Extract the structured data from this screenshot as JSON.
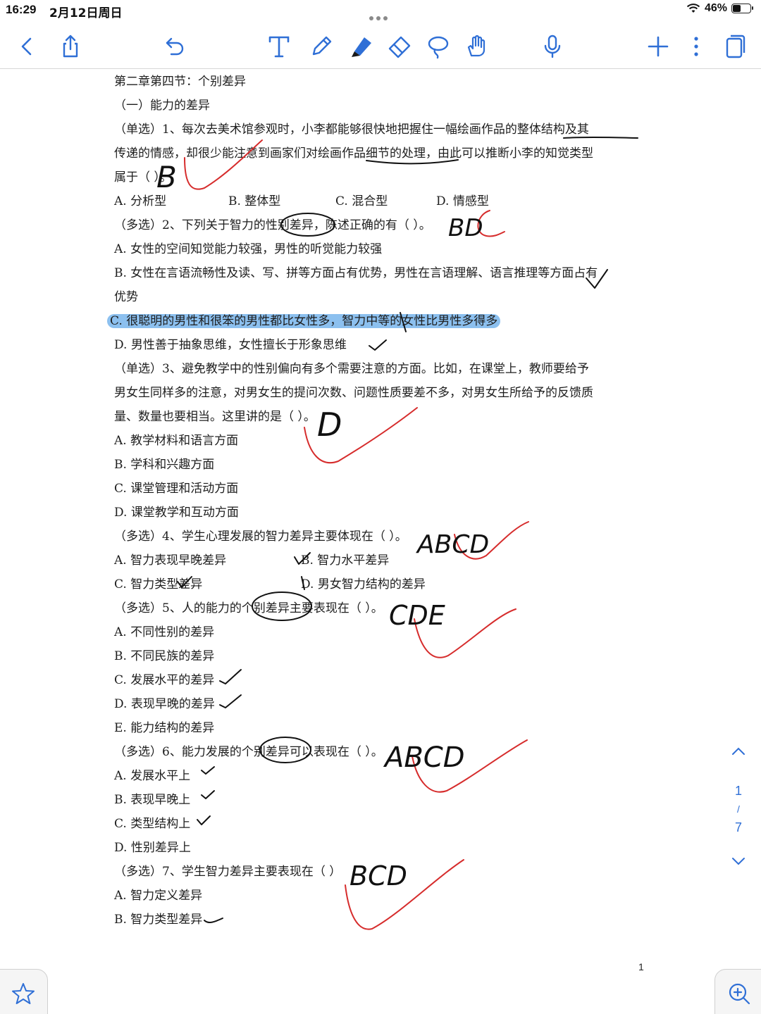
{
  "status": {
    "time": "16:29",
    "date": "2月12日周日",
    "battery": "46%",
    "battery_level": 0.46
  },
  "icons": {
    "back": "chevron-left-icon",
    "share": "share-icon",
    "undo": "undo-icon",
    "text": "text-tool-icon",
    "pen": "pen-icon",
    "highlighter": "highlighter-icon",
    "eraser": "eraser-icon",
    "lasso": "lasso-icon",
    "hand": "hand-tool-icon",
    "mic": "microphone-icon",
    "add": "plus-icon",
    "more": "more-icon",
    "pages": "pages-icon",
    "favorite": "star-icon",
    "zoom": "zoom-in-icon"
  },
  "accent_color": "#2f6fd6",
  "highlight_color": "#8cc0ef",
  "ink_colors": {
    "black": "#111111",
    "red": "#d62c2c"
  },
  "doc": {
    "title": "第二章第四节：个别差异",
    "section": "（一）能力的差异",
    "q1": {
      "line1": "（单选）1、每次去美术馆参观时，小李都能够很快地把握住一幅绘画作品的整体结构及其",
      "line2": "传递的情感，却很少能注意到画家们对绘画作品细节的处理，由此可以推断小李的知觉类型",
      "line3": "属于（    ）。",
      "opts": [
        "A. 分析型",
        "B. 整体型",
        "C. 混合型",
        "D. 情感型"
      ]
    },
    "q2": {
      "stem": "（多选）2、下列关于智力的性别差异，陈述正确的有（    ）。",
      "a": "A. 女性的空间知觉能力较强，男性的听觉能力较强",
      "b1": "B. 女性在言语流畅性及读、写、拼等方面占有优势，男性在言语理解、语言推理等方面占有",
      "b2": "优势",
      "c": "C. 很聪明的男性和很笨的男性都比女性多，智力中等的女性比男性多得多",
      "d": "D. 男性善于抽象思维，女性擅长于形象思维"
    },
    "q3": {
      "line1": "（单选）3、避免教学中的性别偏向有多个需要注意的方面。比如，在课堂上，教师要给予",
      "line2": "男女生同样多的注意，对男女生的提问次数、问题性质要差不多，对男女生所给予的反馈质",
      "line3": "量、数量也要相当。这里讲的是（    ）。",
      "a": "A. 教学材料和语言方面",
      "b": "B. 学科和兴趣方面",
      "c": "C. 课堂管理和活动方面",
      "d": "D. 课堂教学和互动方面"
    },
    "q4": {
      "stem": "（多选）4、学生心理发展的智力差异主要体现在（    ）。",
      "a": "A. 智力表现早晚差异",
      "b": "B. 智力水平差异",
      "c": "C. 智力类型差异",
      "d": "D. 男女智力结构的差异"
    },
    "q5": {
      "stem": "（多选）5、人的能力的个别差异主要表现在（    ）。",
      "a": "A. 不同性别的差异",
      "b": "B. 不同民族的差异",
      "c": "C. 发展水平的差异",
      "d": "D. 表现早晚的差异",
      "e": "E. 能力结构的差异"
    },
    "q6": {
      "stem": "（多选）6、能力发展的个别差异可以表现在（    ）。",
      "a": "A. 发展水平上",
      "b": "B. 表现早晚上",
      "c": "C. 类型结构上",
      "d": "D. 性别差异上"
    },
    "q7": {
      "stem": "（多选）7、学生智力差异主要表现在（    ）",
      "a": "A. 智力定义差异",
      "b": "B. 智力类型差异"
    },
    "page_number": "1"
  },
  "handwriting": {
    "q1": "B",
    "q2": "BD",
    "q3": "D",
    "q4": "ABCD",
    "q5": "CDE",
    "q6": "ABCD",
    "q7": "BCD"
  },
  "nav": {
    "current_page": "1",
    "separator": "/",
    "total_pages": "7"
  }
}
